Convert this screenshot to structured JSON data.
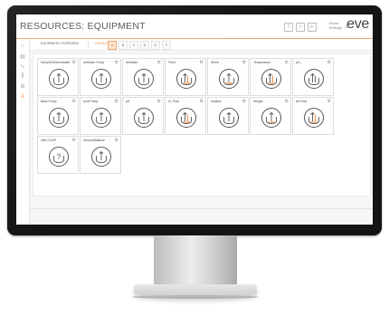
{
  "app": {
    "title": "RESOURCES: EQUIPMENT",
    "logo": "eve",
    "user_name": "Name",
    "user_role": "Settings",
    "header_icons": [
      "?",
      "↗",
      "⊳"
    ]
  },
  "sidebar": {
    "items": [
      {
        "icon": "home-icon",
        "glyph": "⌂",
        "active": false
      },
      {
        "icon": "document-icon",
        "glyph": "▤",
        "active": false
      },
      {
        "icon": "chart-icon",
        "glyph": "∿",
        "active": false
      },
      {
        "icon": "library-icon",
        "glyph": "⫼",
        "active": false
      },
      {
        "icon": "gear-icon",
        "glyph": "⚙",
        "active": false
      },
      {
        "icon": "equipment-icon",
        "glyph": "♙",
        "active": true
      }
    ]
  },
  "subnav": {
    "tab": "EQUIPMENT OVERVIEW",
    "layout_label": "LAYOUT:",
    "layout_options": [
      "A",
      "B",
      "C",
      "D",
      "E",
      "F"
    ],
    "selected_option": "A"
  },
  "cards": [
    {
      "title": "Sample/Dewheatable",
      "accent": "#555555",
      "kind": "arrow"
    },
    {
      "title": "Antifoam Pump",
      "accent": "#555555",
      "kind": "arrow"
    },
    {
      "title": "Antifoam",
      "accent": "#555555",
      "kind": "arrow"
    },
    {
      "title": "Feed",
      "accent": "#f08030",
      "kind": "dual"
    },
    {
      "title": "Stirrer",
      "accent": "#f08030",
      "kind": "arrow"
    },
    {
      "title": "Temperature",
      "accent": "#f08030",
      "kind": "dual"
    },
    {
      "title": "pO₂",
      "accent": "#555555",
      "kind": "dual"
    },
    {
      "title": "Base Pump",
      "accent": "#555555",
      "kind": "arrow"
    },
    {
      "title": "Acid Pump",
      "accent": "#555555",
      "kind": "arrow"
    },
    {
      "title": "pH",
      "accent": "#555555",
      "kind": "arrow"
    },
    {
      "title": "O₂ Flow",
      "accent": "#f08030",
      "kind": "dual"
    },
    {
      "title": "Inactive",
      "accent": "#555555",
      "kind": "arrow"
    },
    {
      "title": "Weight",
      "accent": "#f08030",
      "kind": "arrow"
    },
    {
      "title": "Air Flow",
      "accent": "#f08030",
      "kind": "dual"
    },
    {
      "title": "Offs CO2/P",
      "accent": "#555555",
      "kind": "question"
    },
    {
      "title": "Sensor/Balance",
      "accent": "#555555",
      "kind": "arrow"
    }
  ],
  "card_gear_glyph": "⚙"
}
